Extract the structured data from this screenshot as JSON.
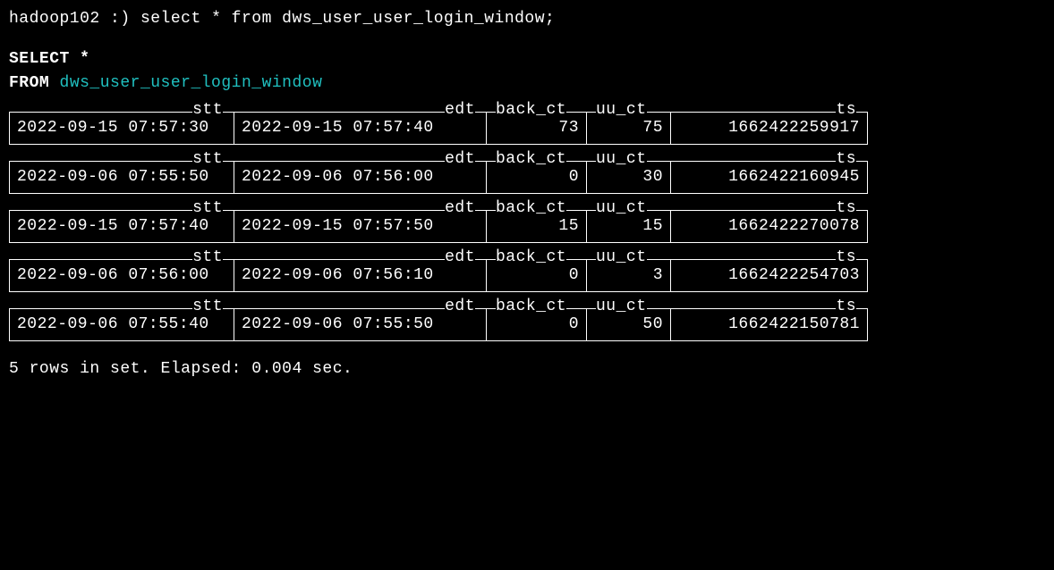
{
  "prompt": {
    "host": "hadoop102",
    "symbol": ":)",
    "command": "select * from dws_user_user_login_window;"
  },
  "echo": {
    "select": "SELECT *",
    "from_kw": "FROM",
    "table": "dws_user_user_login_window"
  },
  "columns": {
    "stt": "stt",
    "edt": "edt",
    "back_ct": "back_ct",
    "uu_ct": "uu_ct",
    "ts": "ts"
  },
  "rows": [
    {
      "stt": "2022-09-15 07:57:30",
      "edt": "2022-09-15 07:57:40",
      "back_ct": "73",
      "uu_ct": "75",
      "ts": "1662422259917"
    },
    {
      "stt": "2022-09-06 07:55:50",
      "edt": "2022-09-06 07:56:00",
      "back_ct": "0",
      "uu_ct": "30",
      "ts": "1662422160945"
    },
    {
      "stt": "2022-09-15 07:57:40",
      "edt": "2022-09-15 07:57:50",
      "back_ct": "15",
      "uu_ct": "15",
      "ts": "1662422270078"
    },
    {
      "stt": "2022-09-06 07:56:00",
      "edt": "2022-09-06 07:56:10",
      "back_ct": "0",
      "uu_ct": "3",
      "ts": "1662422254703"
    },
    {
      "stt": "2022-09-06 07:55:40",
      "edt": "2022-09-06 07:55:50",
      "back_ct": "0",
      "uu_ct": "50",
      "ts": "1662422150781"
    }
  ],
  "footer": {
    "rows_in_set": "5 rows in set.",
    "elapsed_label": "Elapsed:",
    "elapsed_value": "0.004 sec."
  }
}
